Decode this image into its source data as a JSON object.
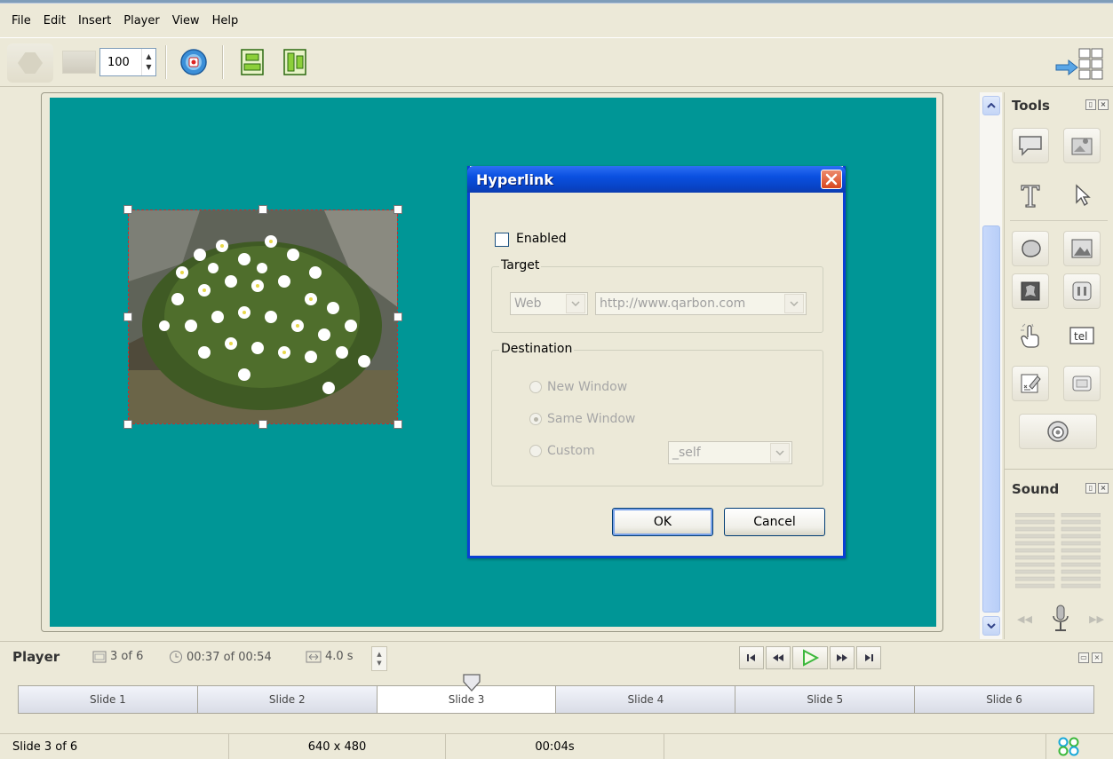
{
  "menu": [
    "File",
    "Edit",
    "Insert",
    "Player",
    "View",
    "Help"
  ],
  "toolbar": {
    "zoom_value": "100"
  },
  "dialog": {
    "title": "Hyperlink",
    "enabled_label": "Enabled",
    "enabled_checked": false,
    "target_legend": "Target",
    "target_type": "Web",
    "target_url": "http://www.qarbon.com",
    "destination_legend": "Destination",
    "radio_new_window": "New Window",
    "radio_same_window": "Same Window",
    "radio_custom": "Custom",
    "custom_value": "_self",
    "selected_destination": "Same Window",
    "ok_label": "OK",
    "cancel_label": "Cancel"
  },
  "panels": {
    "tools_title": "Tools",
    "sound_title": "Sound"
  },
  "player": {
    "title": "Player",
    "slide_counter": "3 of 6",
    "time_counter": "00:37 of 00:54",
    "duration": "4.0 s",
    "slides": [
      "Slide 1",
      "Slide 2",
      "Slide 3",
      "Slide 4",
      "Slide 5",
      "Slide 6"
    ],
    "active_slide": "Slide 3"
  },
  "status": {
    "slide_info": "Slide 3 of 6",
    "resolution": "640 x 480",
    "time": "00:04s"
  },
  "colors": {
    "slide_background": "#009696",
    "dialog_title_blue": "#0a50e0",
    "play_green": "#3cb83c"
  }
}
